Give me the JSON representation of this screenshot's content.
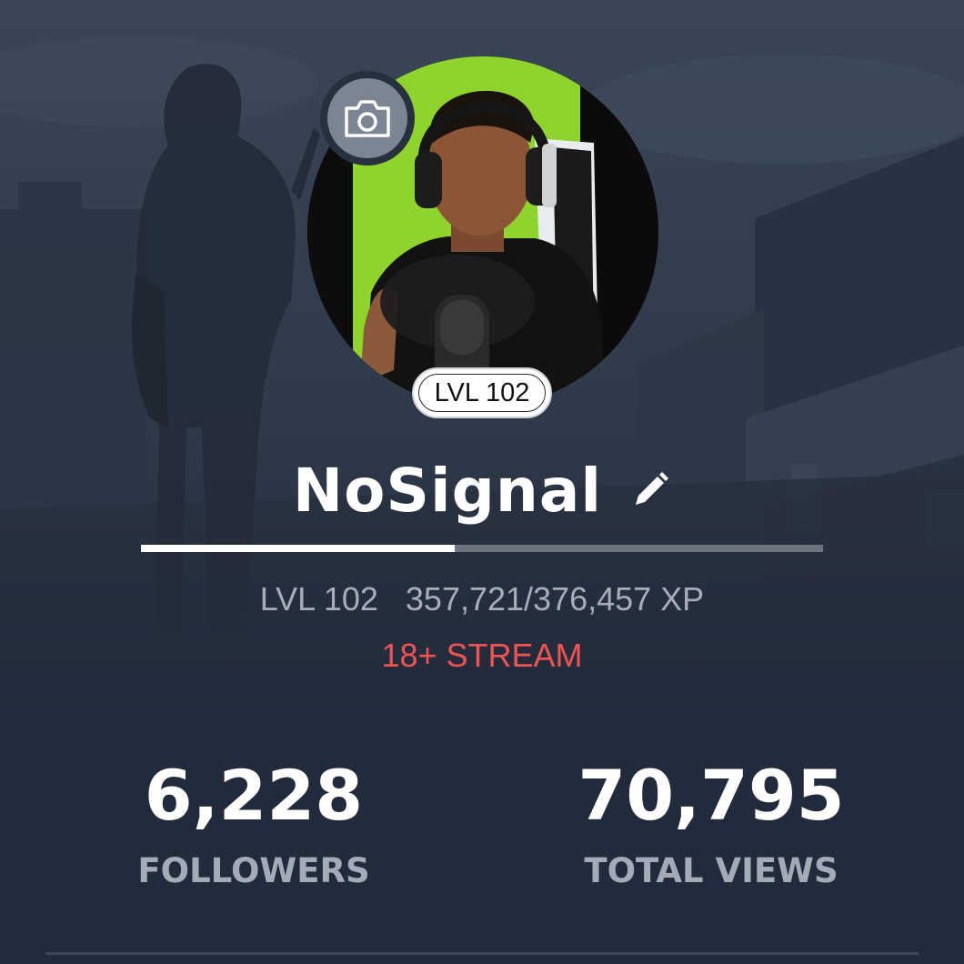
{
  "profile": {
    "username": "NoSignal",
    "level_badge": "LVL 102",
    "level_text": "LVL 102",
    "xp_text": "357,721/376,457 XP",
    "xp_current": 357721,
    "xp_max": 376457,
    "xp_progress_fraction": 0.46,
    "stream_tag": "18+ STREAM"
  },
  "stats": {
    "followers_value": "6,228",
    "followers_label": "FOLLOWERS",
    "views_value": "70,795",
    "views_label": "TOTAL VIEWS"
  },
  "icons": {
    "camera": "camera-icon",
    "edit": "pencil-icon"
  },
  "colors": {
    "background": "#222b3b",
    "stream_tag": "#ef5353",
    "avatar_green": "#8fd42c",
    "xp_fill": "#ffffff",
    "xp_track": "#6c7480"
  }
}
